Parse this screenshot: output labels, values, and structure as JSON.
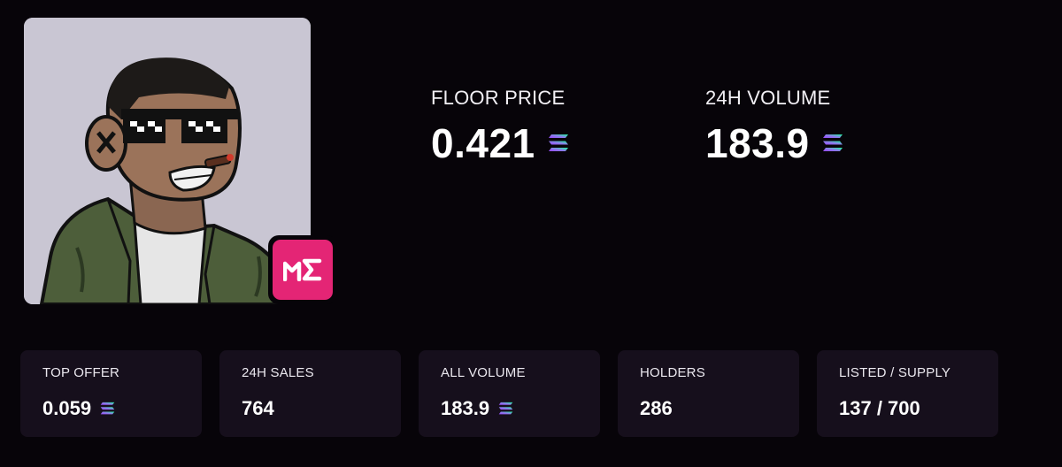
{
  "badge": {
    "text": "ME",
    "bg_color": "#e42575"
  },
  "hero": {
    "floor_label": "FLOOR PRICE",
    "floor_value": "0.421",
    "volume_label": "24H VOLUME",
    "volume_value": "183.9"
  },
  "stats": [
    {
      "label": "TOP OFFER",
      "value": "0.059",
      "currency_icon": "solana-icon"
    },
    {
      "label": "24H SALES",
      "value": "764"
    },
    {
      "label": "ALL VOLUME",
      "value": "183.9",
      "currency_icon": "solana-icon"
    },
    {
      "label": "HOLDERS",
      "value": "286"
    },
    {
      "label": "LISTED / SUPPLY",
      "value": "137 / 700"
    }
  ],
  "colors": {
    "background": "#070409",
    "card": "#160f1c",
    "accent": "#e42575"
  }
}
